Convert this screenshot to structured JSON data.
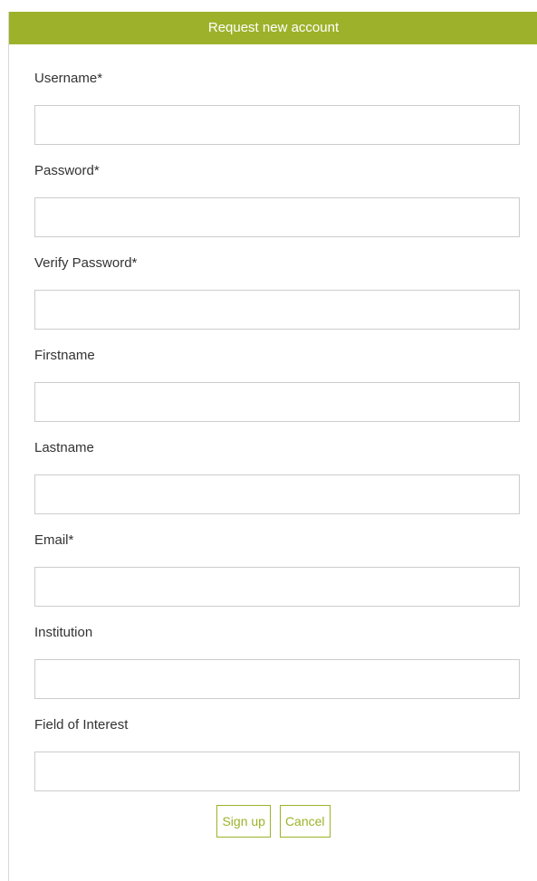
{
  "header": {
    "title": "Request new account"
  },
  "form": {
    "fields": [
      {
        "label": "Username*",
        "value": "",
        "placeholder": ""
      },
      {
        "label": "Password*",
        "value": "",
        "placeholder": ""
      },
      {
        "label": "Verify Password*",
        "value": "",
        "placeholder": ""
      },
      {
        "label": "Firstname",
        "value": "",
        "placeholder": ""
      },
      {
        "label": "Lastname",
        "value": "",
        "placeholder": ""
      },
      {
        "label": "Email*",
        "value": "",
        "placeholder": ""
      },
      {
        "label": "Institution",
        "value": "",
        "placeholder": ""
      },
      {
        "label": "Field of Interest",
        "value": "",
        "placeholder": ""
      }
    ]
  },
  "actions": {
    "signup_label": "Sign up",
    "cancel_label": "Cancel"
  },
  "colors": {
    "accent": "#9db22a",
    "border": "#cccccc",
    "text": "#333333"
  }
}
